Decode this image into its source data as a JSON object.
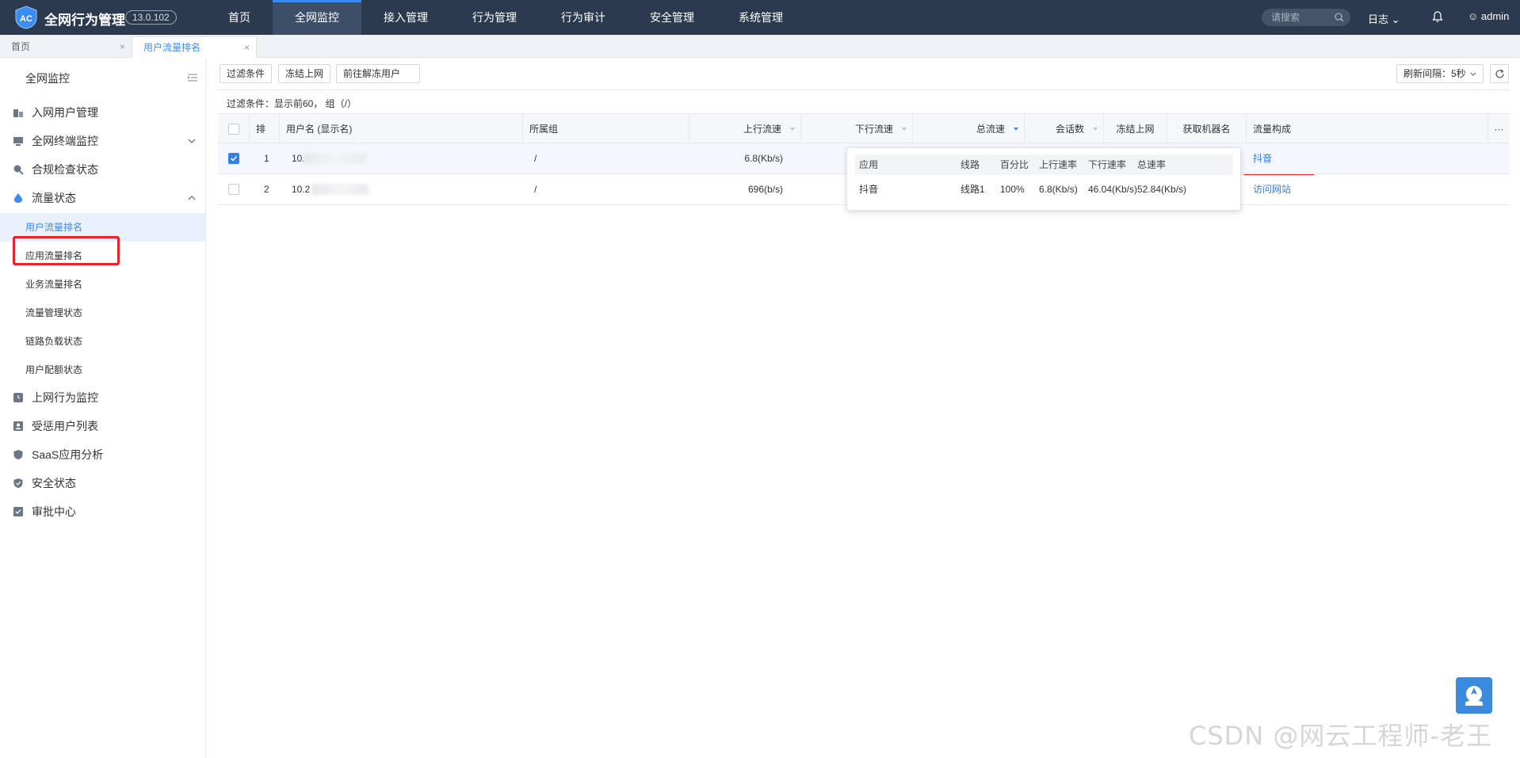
{
  "app": {
    "brand": "全网行为管理",
    "version": "13.0.102"
  },
  "nav": [
    "首页",
    "全网监控",
    "接入管理",
    "行为管理",
    "行为审计",
    "安全管理",
    "系统管理"
  ],
  "topbar": {
    "search_placeholder": "请搜索",
    "log": "日志",
    "user": "admin"
  },
  "tabs": [
    {
      "label": "首页"
    },
    {
      "label": "用户流量排名"
    }
  ],
  "sidebar": {
    "title": "全网监控",
    "menus": [
      {
        "label": "入网用户管理"
      },
      {
        "label": "全网终端监控"
      },
      {
        "label": "合规检查状态"
      },
      {
        "label": "流量状态"
      },
      {
        "label": "上网行为监控"
      },
      {
        "label": "受惩用户列表"
      },
      {
        "label": "SaaS应用分析"
      },
      {
        "label": "安全状态"
      },
      {
        "label": "审批中心"
      }
    ],
    "submenus": [
      "用户流量排名",
      "应用流量排名",
      "业务流量排名",
      "流量管理状态",
      "链路负载状态",
      "用户配额状态"
    ]
  },
  "toolbar": {
    "filter": "过滤条件",
    "freeze": "冻结上网",
    "unfreeze": "前往解冻用户",
    "refresh": "刷新间隔：5秒"
  },
  "filter_text": "过滤条件：显示前60， 组（/）",
  "table": {
    "headers": [
      "排名",
      "用户名 (显示名)",
      "所属组",
      "上行流速",
      "下行流速",
      "总流速",
      "会话数",
      "冻结上网",
      "获取机器名",
      "流量构成"
    ],
    "rows": [
      {
        "rank": "1",
        "user": "10.",
        "group": "/",
        "up": "6.8(Kb/s)",
        "composition": "抖音",
        "selected": true
      },
      {
        "rank": "2",
        "user": "10.2",
        "group": "/",
        "up": "696(b/s)",
        "composition": "访问网站",
        "selected": false
      }
    ]
  },
  "popup": {
    "headers": [
      "应用",
      "线路",
      "百分比",
      "上行速率",
      "下行速率",
      "总速率"
    ],
    "row": [
      "抖音",
      "线路1",
      "100%",
      "6.8(Kb/s)",
      "46.04(Kb/s)",
      "52.84(Kb/s)"
    ]
  },
  "watermark": "CSDN @网云工程师-老王",
  "colors": {
    "topbar": "#2b3a4f",
    "accent": "#3b8bf5",
    "highlight": "#e4262b"
  }
}
